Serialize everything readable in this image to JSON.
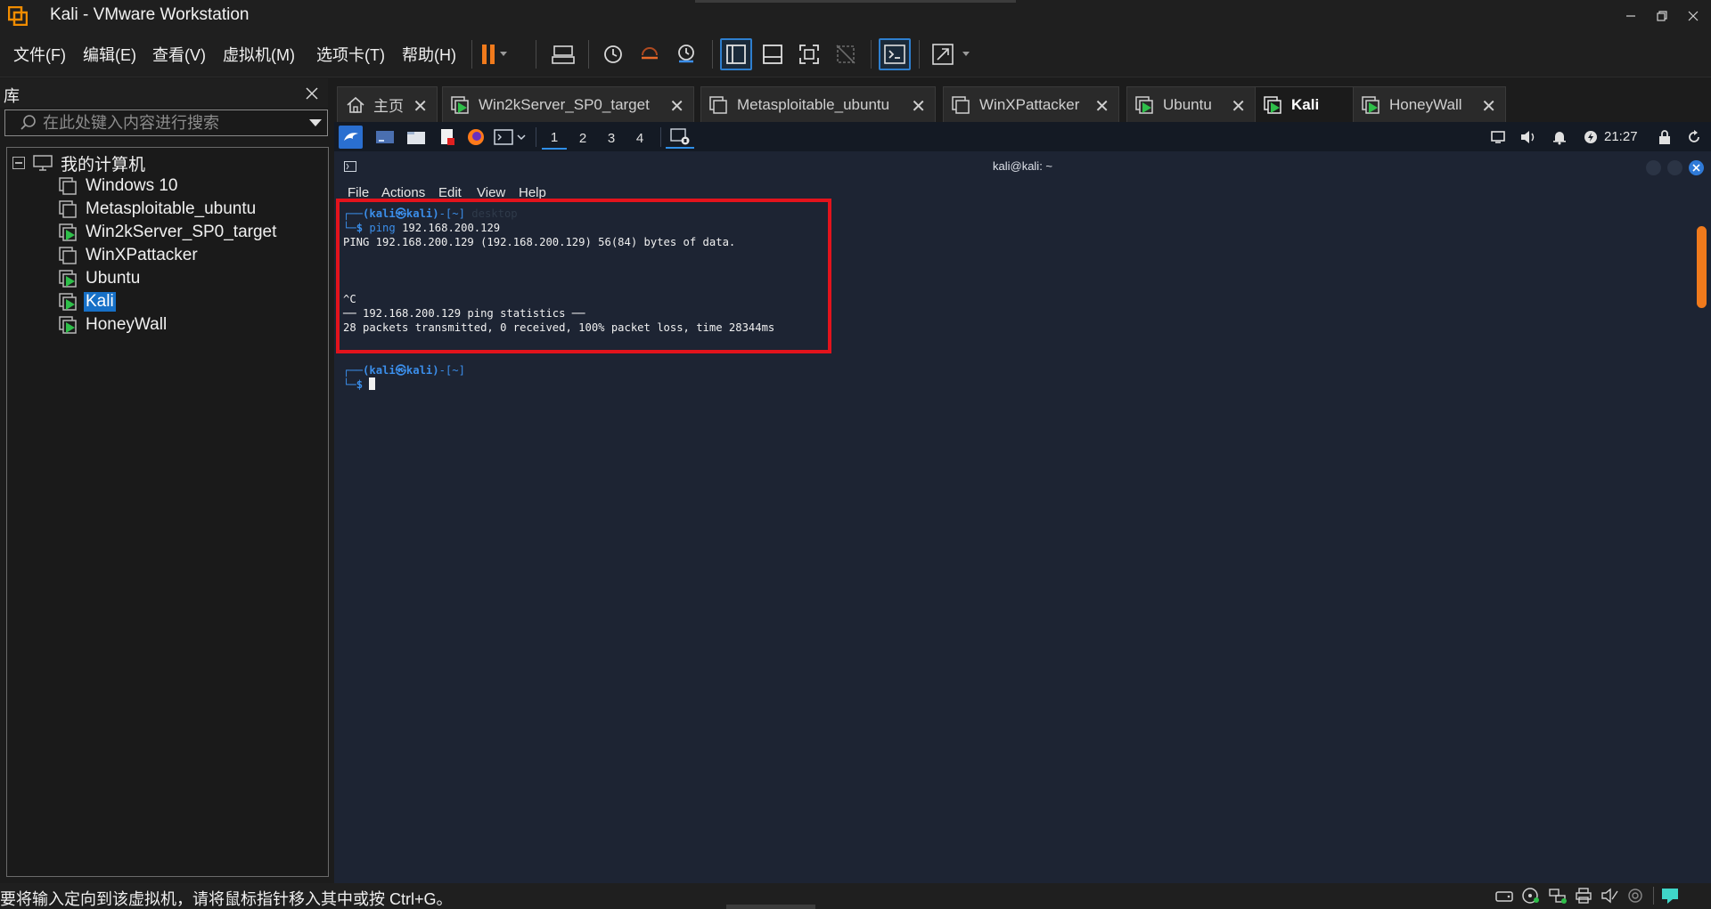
{
  "window": {
    "title": "Kali - VMware Workstation"
  },
  "menu": {
    "items": [
      "文件(F)",
      "编辑(E)",
      "查看(V)",
      "虚拟机(M)",
      "选项卡(T)",
      "帮助(H)"
    ]
  },
  "library": {
    "title": "库",
    "search_placeholder": "在此处键入内容进行搜索",
    "root_label": "我的计算机",
    "vms": [
      "Windows 10",
      "Metasploitable_ubuntu",
      "Win2kServer_SP0_target",
      "WinXPattacker",
      "Ubuntu",
      "Kali",
      "HoneyWall"
    ],
    "selected": "Kali"
  },
  "tabs": [
    {
      "label": "主页",
      "icon": "home-icon"
    },
    {
      "label": "Win2kServer_SP0_target",
      "icon": "vm-running-icon"
    },
    {
      "label": "Metasploitable_ubuntu",
      "icon": "vm-icon"
    },
    {
      "label": "WinXPattacker",
      "icon": "vm-icon"
    },
    {
      "label": "Ubuntu",
      "icon": "vm-running-icon"
    },
    {
      "label": "Kali",
      "icon": "vm-running-icon",
      "active": true
    },
    {
      "label": "HoneyWall",
      "icon": "vm-running-icon"
    }
  ],
  "guest_panel": {
    "workspaces": [
      "1",
      "2",
      "3",
      "4"
    ],
    "active_workspace": "1",
    "clock": "21:27"
  },
  "terminal": {
    "title": "kali@kali: ~",
    "menu": [
      "File",
      "Actions",
      "Edit",
      "View",
      "Help"
    ],
    "lines": {
      "prompt1_user": "(kali㉿kali)",
      "prompt1_dir": "-[~]",
      "prompt1_ghost": "desktop",
      "cmd_word": "ping",
      "cmd_arg": "192.168.200.129",
      "ping_header": "PING 192.168.200.129 (192.168.200.129) 56(84) bytes of data.",
      "interrupt": "^C",
      "stats_header": "── 192.168.200.129 ping statistics ──",
      "stats_summary": "28 packets transmitted, 0 received, 100% packet loss, time 28344ms",
      "prompt2_user": "(kali㉿kali)",
      "prompt2_dir": "-[~]",
      "prompt_symbol": "$"
    }
  },
  "status": {
    "message": "要将输入定向到该虚拟机，请将鼠标指针移入其中或按 Ctrl+G。"
  },
  "colors": {
    "highlight_box": "#e3131c",
    "accent": "#1670c7",
    "kali_blue": "#3b8eea",
    "scroll_thumb": "#f07a1c"
  }
}
